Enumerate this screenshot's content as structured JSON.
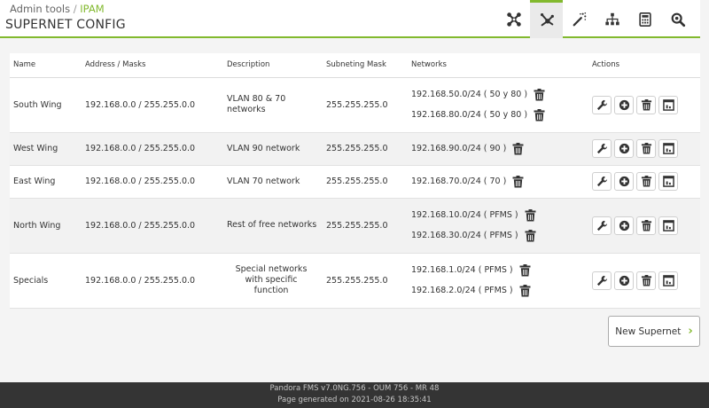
{
  "header": {
    "breadcrumb": [
      "Admin tools",
      "IPAM"
    ],
    "breadcrumb_sep": " / ",
    "title": "SUPERNET CONFIG",
    "tabs": [
      {
        "icon": "network-tools-icon",
        "active": false
      },
      {
        "icon": "supernet-icon",
        "active": true
      },
      {
        "icon": "wizard-icon",
        "active": false
      },
      {
        "icon": "sitemap-icon",
        "active": false
      },
      {
        "icon": "calculator-icon",
        "active": false
      },
      {
        "icon": "search-icon",
        "active": false
      }
    ]
  },
  "table": {
    "columns": [
      "Name",
      "Address / Masks",
      "Description",
      "Subneting Mask",
      "Networks",
      "Actions"
    ],
    "rows": [
      {
        "name": "South Wing",
        "address": "192.168.0.0 / 255.255.0.0",
        "description": "VLAN 80 & 70 networks",
        "mask": "255.255.255.0",
        "networks": [
          "192.168.50.0/24 ( 50 y 80 )",
          "192.168.80.0/24 ( 50 y 80 )"
        ]
      },
      {
        "name": "West Wing",
        "address": "192.168.0.0 / 255.255.0.0",
        "description": "VLAN 90 network",
        "mask": "255.255.255.0",
        "networks": [
          "192.168.90.0/24 ( 90 )"
        ]
      },
      {
        "name": "East Wing",
        "address": "192.168.0.0 / 255.255.0.0",
        "description": "VLAN 70 network",
        "mask": "255.255.255.0",
        "networks": [
          "192.168.70.0/24 ( 70 )"
        ]
      },
      {
        "name": "North Wing",
        "address": "192.168.0.0 / 255.255.0.0",
        "description": "Rest of free networks",
        "mask": "255.255.255.0",
        "networks": [
          "192.168.10.0/24 ( PFMS )",
          "192.168.30.0/24 ( PFMS )"
        ]
      },
      {
        "name": "Specials",
        "address": "192.168.0.0 / 255.255.0.0",
        "description": "Special networks with specific function",
        "mask": "255.255.255.0",
        "networks": [
          "192.168.1.0/24 ( PFMS )",
          "192.168.2.0/24 ( PFMS )"
        ]
      }
    ],
    "action_icons": [
      "wrench-icon",
      "add-icon",
      "trash-icon",
      "chart-icon"
    ]
  },
  "new_button": {
    "label": "New Supernet"
  },
  "footer": {
    "line1": "Pandora FMS v7.0NG.756 - OUM 756 - MR 48",
    "line2": "Page generated on 2021-08-26 18:35:41"
  },
  "colors": {
    "accent": "#82b92e",
    "footer_bg": "#343434",
    "row_alt": "#f2f2f2"
  }
}
